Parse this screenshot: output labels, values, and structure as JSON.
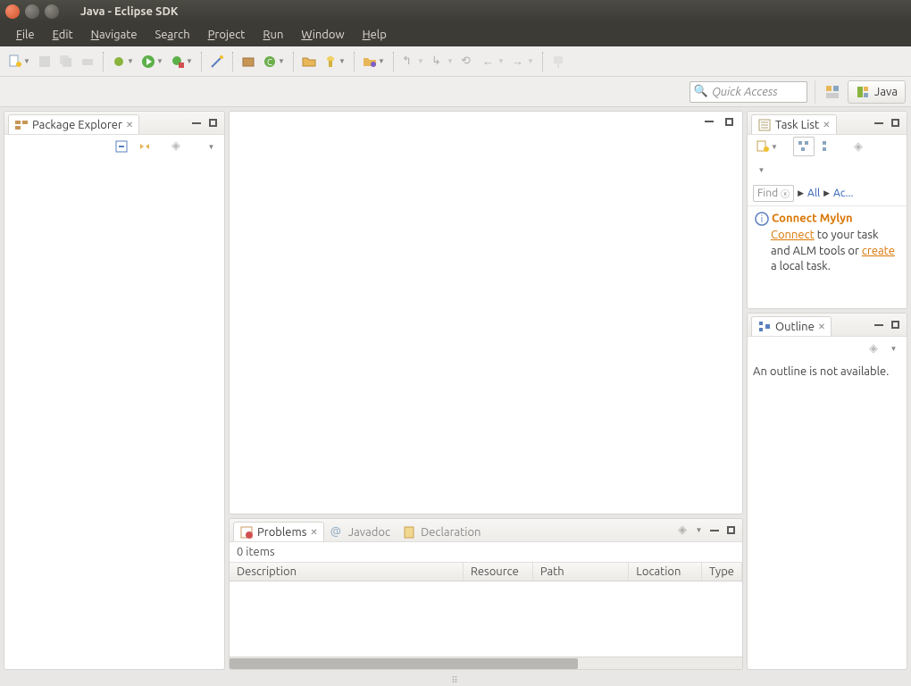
{
  "window": {
    "title": "Java - Eclipse SDK"
  },
  "menus": [
    "File",
    "Edit",
    "Navigate",
    "Search",
    "Project",
    "Run",
    "Window",
    "Help"
  ],
  "quickaccess": {
    "placeholder": "Quick Access"
  },
  "perspective": {
    "label": "Java"
  },
  "packageExplorer": {
    "title": "Package Explorer"
  },
  "taskList": {
    "title": "Task List",
    "find": "Find",
    "all": "All",
    "activate": "Ac...",
    "mylyn": {
      "heading": "Connect Mylyn",
      "connect": "Connect",
      "mid": " to your task and ALM tools or ",
      "create": "create",
      "end": " a local task."
    }
  },
  "outline": {
    "title": "Outline",
    "empty": "An outline is not available."
  },
  "problems": {
    "tab_problems": "Problems",
    "tab_javadoc": "Javadoc",
    "tab_declaration": "Declaration",
    "items": "0 items",
    "cols": {
      "description": "Description",
      "resource": "Resource",
      "path": "Path",
      "location": "Location",
      "type": "Type"
    }
  }
}
